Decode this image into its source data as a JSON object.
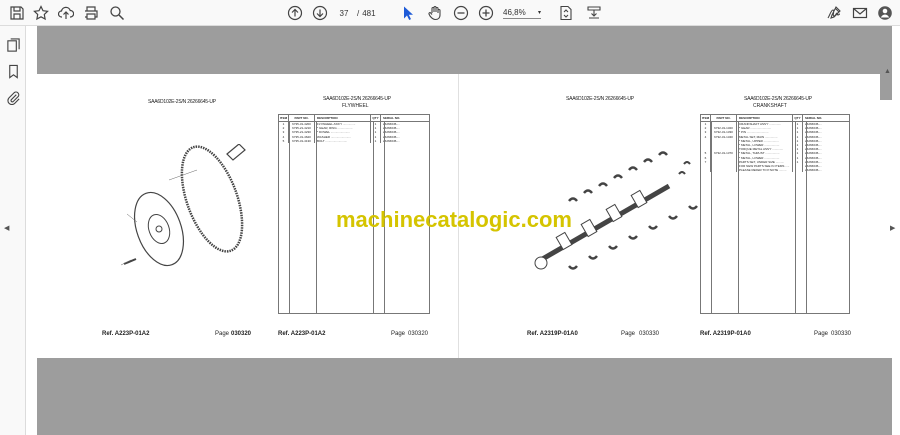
{
  "toolbar": {
    "current_page": "37",
    "page_separator": "/",
    "total_pages": "481",
    "zoom": "46,8%"
  },
  "pages": [
    {
      "model": "SAA6D102E-2S/N 26266645-UP",
      "model2": "SAA6D102E-2S/N 26266645-UP",
      "title": "FLYWHEEL",
      "columns": [
        "ITEM",
        "PART NO.",
        "DESCRIPTION",
        "QTY",
        "SERIAL NO."
      ],
      "rows": [
        [
          "1",
          "6735-31-4200",
          "FLYWHEEL ASS'Y ...............",
          "1",
          "26266645-..."
        ],
        [
          "2",
          "6735-21-4210",
          "* GEAR, RING ..................",
          "1",
          "26266645-..."
        ],
        [
          "3",
          "6735-21-4230",
          "* DOWEL .......................",
          "1",
          "26266645-..."
        ],
        [
          "4",
          "6735-31-4620",
          "WASHER ........................",
          "1",
          "26266645-..."
        ],
        [
          "5",
          "6735-31-4130",
          "BOLT ..........................",
          "1",
          "26266645-..."
        ]
      ],
      "ref_label": "Ref. A223P-01A2",
      "ref_label2": "Ref. A223P-01A2",
      "page_label": "Page",
      "page_label2": "Page",
      "page_no": "030320",
      "page_no2": "030320"
    },
    {
      "model": "SAA6D102E-2S/N 26266645-UP",
      "model2": "SAA6D102E-2S/N 26266645-UP",
      "title": "CRANKSHAFT",
      "columns": [
        "ITEM",
        "PART NO.",
        "DESCRIPTION",
        "QTY",
        "SERIAL NO."
      ],
      "rows": [
        [
          "1",
          "",
          "CRANKSHAFT ASS'Y ..............",
          "1",
          "26266645-..."
        ],
        [
          "2",
          "6732-31-1320",
          "* GEAR .........................",
          "1",
          "26266645-..."
        ],
        [
          "3",
          "6732-31-1330",
          "* PIN ..........................",
          "1",
          "26266645-..."
        ],
        [
          "4",
          "6732-31-1340",
          "METAL SET, MAIN ...............",
          "1",
          "26266645-..."
        ],
        [
          "",
          "",
          "* METAL, UPPER ..................",
          "1",
          "26266645-..."
        ],
        [
          "",
          "",
          "* METAL, LOWER ..................",
          "1",
          "26266645-..."
        ],
        [
          "",
          "",
          "TORQUE METAL ASS'Y .............",
          "1",
          "26266645-..."
        ],
        [
          "5",
          "6732-31-1370",
          "* METAL, THRUST .................",
          "1",
          "26266645-..."
        ],
        [
          "6",
          "",
          "* METAL, LOWER ..................",
          "1",
          "26266645-..."
        ],
        [
          "7",
          "",
          "PARTS SET, UNDER SIZE ..........",
          "1",
          "26266645-..."
        ],
        [
          "",
          "",
          "FOR NEW PARTS SEE IN ITEMS .....",
          "",
          "26266645-..."
        ],
        [
          "",
          "",
          "PLEASE REFER TO P.NOTE .........",
          "",
          "26266645-..."
        ]
      ],
      "ref_label": "Ref. A2319P-01A0",
      "ref_label2": "Ref. A2319P-01A0",
      "page_label": "Page",
      "page_label2": "Page",
      "page_no": "030330",
      "page_no2": "030330"
    }
  ],
  "watermark": "machinecatalogic.com"
}
